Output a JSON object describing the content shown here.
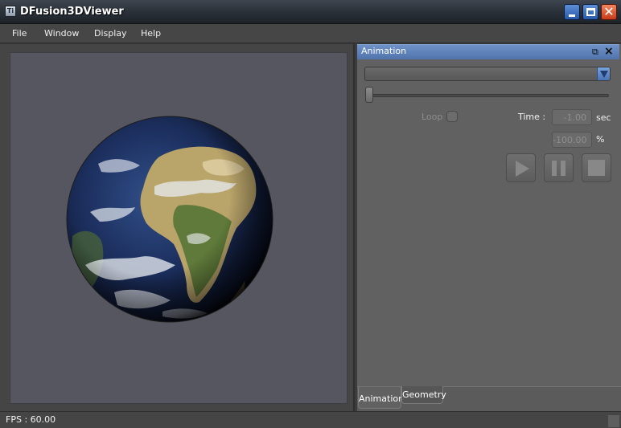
{
  "window": {
    "title": "DFusion3DViewer",
    "icon": "app-icon"
  },
  "menu": [
    {
      "label": "File"
    },
    {
      "label": "Window"
    },
    {
      "label": "Display"
    },
    {
      "label": "Help"
    }
  ],
  "viewport": {
    "background": "#555660",
    "object": "earth-globe"
  },
  "panel": {
    "title": "Animation",
    "animation_select": {
      "value": ""
    },
    "slider": {
      "value": 0
    },
    "loop": {
      "label": "Loop",
      "checked": false
    },
    "time": {
      "label": "Time :",
      "value": "-1.00",
      "unit": "sec"
    },
    "percent": {
      "value": "-100.00",
      "unit": "%"
    },
    "controls": {
      "play": "play-icon",
      "pause": "pause-icon",
      "stop": "stop-icon"
    },
    "tabs": [
      {
        "label": "Animation",
        "active": true
      },
      {
        "label": "Geometry",
        "active": false
      }
    ]
  },
  "status": {
    "fps": "FPS : 60.00"
  },
  "colors": {
    "panel_header": "#5b80bb",
    "accent": "#4a72b4",
    "close": "#d9502b"
  }
}
